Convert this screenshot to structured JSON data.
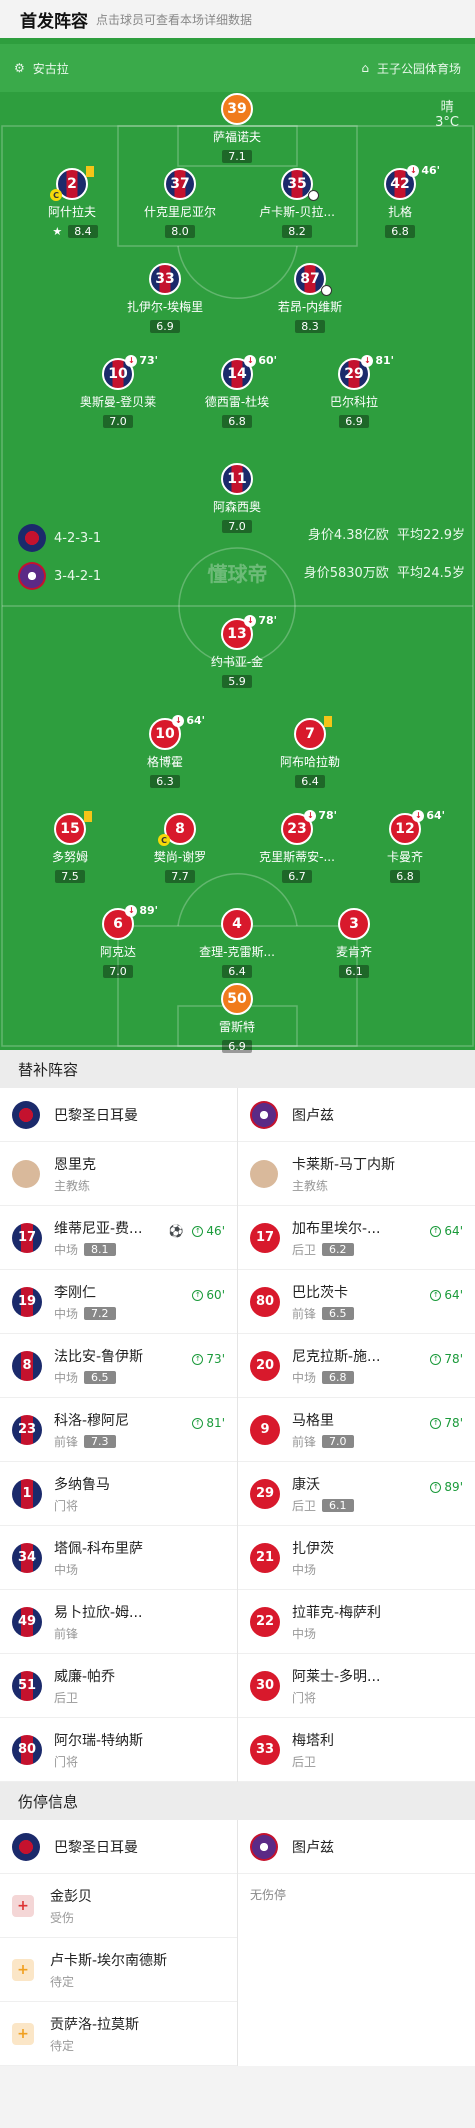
{
  "header": {
    "title": "首发阵容",
    "hint": "点击球员可查看本场详细数据"
  },
  "info": {
    "referee": "安古拉",
    "stadium": "王子公园体育场",
    "weather": "晴",
    "temp": "3°C"
  },
  "teams": {
    "home": {
      "name": "巴黎圣日耳曼",
      "formation": "4-2-3-1",
      "value": "身价4.38亿欧",
      "age": "平均22.9岁"
    },
    "away": {
      "name": "图卢兹",
      "formation": "3-4-2-1",
      "value": "身价5830万欧",
      "age": "平均24.5岁"
    },
    "watermark": "懂球帝"
  },
  "home_lineup": [
    {
      "num": "39",
      "name": "萨福诺夫",
      "rating": "7.1",
      "gk": true
    },
    {
      "num": "2",
      "name": "阿什拉夫",
      "rating": "8.4",
      "star": true,
      "yellow": true,
      "captain": true
    },
    {
      "num": "37",
      "name": "什克里尼亚尔",
      "rating": "8.0"
    },
    {
      "num": "35",
      "name": "卢卡斯-贝拉...",
      "rating": "8.2",
      "goal": true
    },
    {
      "num": "42",
      "name": "扎格",
      "rating": "6.8",
      "subMin": "46'"
    },
    {
      "num": "33",
      "name": "扎伊尔-埃梅里",
      "rating": "6.9"
    },
    {
      "num": "87",
      "name": "若昂-内维斯",
      "rating": "8.3",
      "goal": true
    },
    {
      "num": "10",
      "name": "奥斯曼-登贝莱",
      "rating": "7.0",
      "subMin": "73'"
    },
    {
      "num": "14",
      "name": "德西雷-杜埃",
      "rating": "6.8",
      "subMin": "60'"
    },
    {
      "num": "29",
      "name": "巴尔科拉",
      "rating": "6.9",
      "subMin": "81'"
    },
    {
      "num": "11",
      "name": "阿森西奥",
      "rating": "7.0"
    }
  ],
  "away_lineup": [
    {
      "num": "13",
      "name": "约书亚-金",
      "rating": "5.9",
      "subMin": "78'"
    },
    {
      "num": "10",
      "name": "格博霍",
      "rating": "6.3",
      "subMin": "64'"
    },
    {
      "num": "7",
      "name": "阿布哈拉勒",
      "rating": "6.4",
      "yellow": true
    },
    {
      "num": "15",
      "name": "多努姆",
      "rating": "7.5",
      "yellow": true
    },
    {
      "num": "8",
      "name": "樊尚-谢罗",
      "rating": "7.7",
      "captain": true
    },
    {
      "num": "23",
      "name": "克里斯蒂安-...",
      "rating": "6.7",
      "subMin": "78'"
    },
    {
      "num": "12",
      "name": "卡曼齐",
      "rating": "6.8",
      "subMin": "64'"
    },
    {
      "num": "6",
      "name": "阿克达",
      "rating": "7.0",
      "subMin": "89'"
    },
    {
      "num": "4",
      "name": "查理-克雷斯...",
      "rating": "6.4"
    },
    {
      "num": "3",
      "name": "麦肯齐",
      "rating": "6.1"
    },
    {
      "num": "50",
      "name": "雷斯特",
      "rating": "6.9",
      "gk": true
    }
  ],
  "subs_title": "替补阵容",
  "coach_role": "主教练",
  "home_coach": "恩里克",
  "away_coach": "卡莱斯-马丁内斯",
  "home_subs": [
    {
      "num": "17",
      "name": "维蒂尼亚-费...",
      "pos": "中场",
      "rating": "8.1",
      "min": "46'",
      "goal": true
    },
    {
      "num": "19",
      "name": "李刚仁",
      "pos": "中场",
      "rating": "7.2",
      "min": "60'"
    },
    {
      "num": "8",
      "name": "法比安-鲁伊斯",
      "pos": "中场",
      "rating": "6.5",
      "min": "73'"
    },
    {
      "num": "23",
      "name": "科洛-穆阿尼",
      "pos": "前锋",
      "rating": "7.3",
      "min": "81'"
    },
    {
      "num": "1",
      "name": "多纳鲁马",
      "pos": "门将"
    },
    {
      "num": "34",
      "name": "塔佩-科布里萨",
      "pos": "中场"
    },
    {
      "num": "49",
      "name": "易卜拉欣-姆...",
      "pos": "前锋"
    },
    {
      "num": "51",
      "name": "威廉-帕乔",
      "pos": "后卫"
    },
    {
      "num": "80",
      "name": "阿尔瑞-特纳斯",
      "pos": "门将"
    }
  ],
  "away_subs": [
    {
      "num": "17",
      "name": "加布里埃尔-...",
      "pos": "后卫",
      "rating": "6.2",
      "min": "64'"
    },
    {
      "num": "80",
      "name": "巴比茨卡",
      "pos": "前锋",
      "rating": "6.5",
      "min": "64'"
    },
    {
      "num": "20",
      "name": "尼克拉斯-施...",
      "pos": "中场",
      "rating": "6.8",
      "min": "78'"
    },
    {
      "num": "9",
      "name": "马格里",
      "pos": "前锋",
      "rating": "7.0",
      "min": "78'"
    },
    {
      "num": "29",
      "name": "康沃",
      "pos": "后卫",
      "rating": "6.1",
      "min": "89'"
    },
    {
      "num": "21",
      "name": "扎伊茨",
      "pos": "中场"
    },
    {
      "num": "22",
      "name": "拉菲克-梅萨利",
      "pos": "中场"
    },
    {
      "num": "30",
      "name": "阿莱士-多明...",
      "pos": "门将"
    },
    {
      "num": "33",
      "name": "梅塔利",
      "pos": "后卫"
    }
  ],
  "injury_title": "伤停信息",
  "injuries_home": [
    {
      "name": "金彭贝",
      "status": "受伤",
      "type": "injury"
    },
    {
      "name": "卢卡斯-埃尔南德斯",
      "status": "待定",
      "type": "doubt"
    },
    {
      "name": "贡萨洛-拉莫斯",
      "status": "待定",
      "type": "doubt"
    }
  ],
  "injuries_away_none": "无伤停",
  "colors": {
    "pitch": "#2e9e3e",
    "psg_blue": "#1b2a6b",
    "psg_red": "#c4122e",
    "tfc_red": "#d8192c",
    "gk": "#f07b1c"
  }
}
